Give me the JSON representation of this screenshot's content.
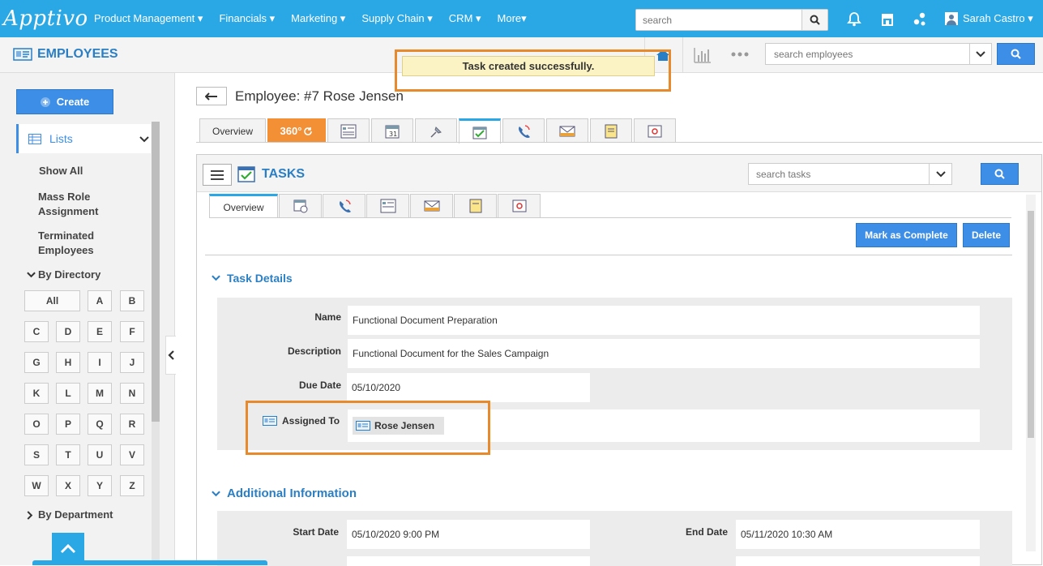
{
  "topbar": {
    "logo": "Apptivo",
    "nav": [
      "Product Management ▾",
      "Financials ▾",
      "Marketing ▾",
      "Supply Chain ▾",
      "CRM ▾",
      "More▾"
    ],
    "search_placeholder": "search",
    "user_name": "Sarah Castro ▾",
    "color": "#2aa8e5"
  },
  "module": {
    "title": "EMPLOYEES",
    "search_placeholder": "search employees",
    "toast": "Task created successfully."
  },
  "sidebar": {
    "create_label": "Create",
    "lists_label": "Lists",
    "show_all": "Show All",
    "mass_role": "Mass Role Assignment",
    "terminated": "Terminated Employees",
    "by_directory": "By Directory",
    "letters": [
      "All",
      "A",
      "B",
      "C",
      "D",
      "E",
      "F",
      "G",
      "H",
      "I",
      "J",
      "K",
      "L",
      "M",
      "N",
      "O",
      "P",
      "Q",
      "R",
      "S",
      "T",
      "U",
      "V",
      "W",
      "X",
      "Y",
      "Z"
    ],
    "by_department": "By Department"
  },
  "employee": {
    "title": "Employee: #7 Rose Jensen",
    "overview_tab": "Overview",
    "tab_360": "360°"
  },
  "tasks": {
    "title": "TASKS",
    "search_placeholder": "search tasks",
    "overview_tab": "Overview",
    "mark_complete": "Mark as Complete",
    "delete": "Delete",
    "task_details": "Task Details",
    "additional_info": "Additional Information",
    "fields": {
      "name_label": "Name",
      "name_value": "Functional Document Preparation",
      "description_label": "Description",
      "description_value": "Functional Document for the Sales Campaign",
      "due_label": "Due Date",
      "due_value": "05/10/2020",
      "assigned_label": "Assigned To",
      "assigned_value": "Rose Jensen",
      "start_label": "Start Date",
      "start_value": "05/10/2020 9:00 PM",
      "end_label": "End Date",
      "end_value": "05/11/2020 10:30 AM"
    }
  }
}
